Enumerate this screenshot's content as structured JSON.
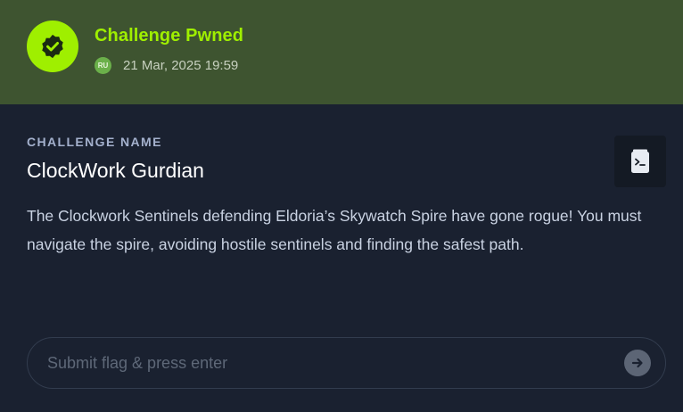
{
  "banner": {
    "status_title": "Challenge Pwned",
    "avatar_initials": "RU",
    "date": "21 Mar, 2025 19:59",
    "accent_color": "#9fef00"
  },
  "challenge": {
    "section_label": "CHALLENGE NAME",
    "name": "ClockWork Gurdian",
    "description": "The Clockwork Sentinels defending Eldoria’s Skywatch Spire have gone rogue! You must navigate the spire, avoiding hostile sentinels and finding the safest path.",
    "doc_icon": "terminal-document-icon"
  },
  "flag": {
    "placeholder": "Submit flag & press enter",
    "submit_icon": "arrow-right-icon"
  }
}
